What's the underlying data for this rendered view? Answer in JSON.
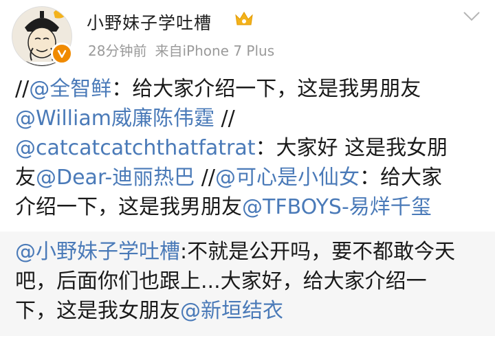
{
  "post": {
    "author_name": "小野妹子学吐槽",
    "time": "28分钟前",
    "source": "来自iPhone 7 Plus"
  },
  "content": {
    "line1": {
      "prefix": "//",
      "mention": "@全智鲜",
      "text": "：给大家介绍一下，这是我男朋友"
    },
    "line2": {
      "mention": "@William威廉陈伟霆",
      "suffix": " //"
    },
    "line3": {
      "mention": "@catcatcatchthatfatrat",
      "text": "：大家好 这是我女朋"
    },
    "line4": {
      "prefix": "友",
      "mention": "@Dear-迪丽热巴",
      "mid": " //",
      "mention2": "@可心是小仙女",
      "text": "：给大家"
    },
    "line5": {
      "text": "介绍一下，这是我男朋友",
      "mention": "@TFBOYS-易烊千玺"
    }
  },
  "retweet": {
    "line1": {
      "mention": "@小野妹子学吐槽",
      "text": ":不就是公开吗，要不都敢今天"
    },
    "line2": {
      "text": "吧，后面你们也跟上...大家好，给大家介绍一"
    },
    "line3": {
      "text": "下，这是我女朋友",
      "mention": "@新垣结衣"
    }
  },
  "icons": {
    "avatar": "avatar-portrait",
    "verified": "verified-badge-icon",
    "member": "crown-icon",
    "menu": "chevron-down-icon"
  },
  "colors": {
    "link": "#4a7ab8",
    "meta": "#9a9a9a",
    "retweet_bg": "#f6f6f6",
    "verified": "#f08a00"
  }
}
